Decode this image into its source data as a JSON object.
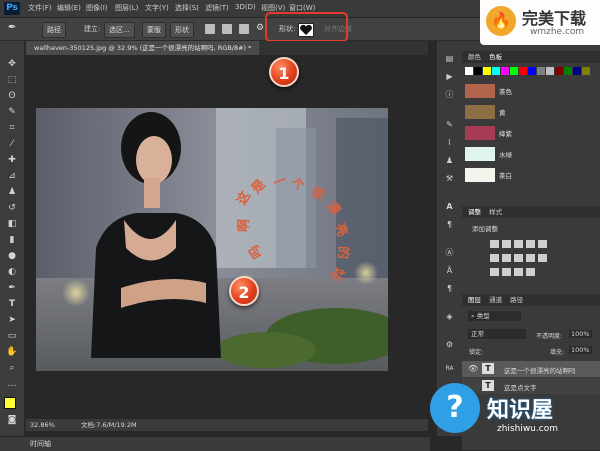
{
  "app": {
    "logo": "Ps"
  },
  "menu": [
    "文件(F)",
    "编辑(E)",
    "图像(I)",
    "图层(L)",
    "文字(Y)",
    "选择(S)",
    "滤镜(T)",
    "3D(D)",
    "视图(V)",
    "窗口(W)"
  ],
  "options": {
    "mode": "路径",
    "make_label": "建立:",
    "selection_btn": "选区...",
    "mask_btn": "蒙版",
    "shape_btn": "形状",
    "shape_label": "形状:",
    "align_edges": "对齐边缘"
  },
  "document": {
    "tab": "wallhaven-350125.jpg @ 32.9% (这是一个很漂亮的站啊吗, RGB/8#) *"
  },
  "markers": {
    "m1": "1",
    "m2": "2"
  },
  "canvas_text": {
    "path_chars": [
      "这",
      "是",
      "一",
      "个",
      "很",
      "漂",
      "亮",
      "的",
      "站",
      "啊",
      "吗"
    ]
  },
  "status": {
    "zoom": "32.86%",
    "doc": "文档:7.6/M/19.2M",
    "timeline": "时间轴"
  },
  "panels": {
    "swatch_tabs": [
      "颜色",
      "色板"
    ],
    "colors": [
      {
        "name": "茶色",
        "hex": "#b2644c"
      },
      {
        "name": "黄",
        "hex": "#8c6e44"
      },
      {
        "name": "绛紫",
        "hex": "#a73a55"
      },
      {
        "name": "水绿",
        "hex": "#dff4ec"
      },
      {
        "name": "茶白",
        "hex": "#f2f5eb"
      }
    ],
    "adjust_tabs": [
      "调整",
      "样式"
    ],
    "adjust_title": "添加调整",
    "layers_tabs": [
      "图层",
      "通道",
      "路径"
    ],
    "layer_kind": "类型",
    "blend_mode": "正常",
    "opacity_label": "不透明度:",
    "opacity_value": "100%",
    "lock_label": "锁定:",
    "fill_label": "填充:",
    "fill_value": "100%",
    "layers": [
      {
        "name": "这是一个很漂亮的站啊吗",
        "type": "T"
      },
      {
        "name": "这是点文字",
        "type": "T"
      }
    ]
  },
  "watermark_top": {
    "title": "完美下载",
    "url": "wmzhe.com"
  },
  "watermark_bottom": {
    "title": "知识屋",
    "url": "zhishiwu.com"
  },
  "swatch_colors": [
    "#ffffff",
    "#000000",
    "#ffff00",
    "#00ffff",
    "#ff00ff",
    "#00ff00",
    "#ff0000",
    "#0000ff",
    "#808080",
    "#c0c0c0",
    "#800000",
    "#008000",
    "#000080",
    "#808000"
  ],
  "accents": {
    "highlight": "#e23a2c",
    "path_text": "#d8623e"
  }
}
